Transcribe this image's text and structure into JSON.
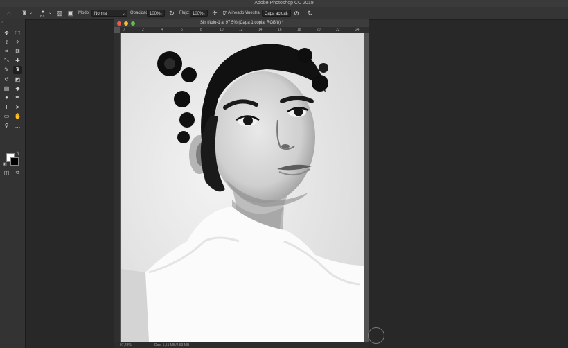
{
  "app": {
    "title": "Adobe Photoshop CC 2019"
  },
  "options": {
    "brush_size": "87",
    "mode_label": "Modo:",
    "mode_value": "Normal",
    "opacity_label": "Opacidad:",
    "opacity_value": "100%",
    "flow_label": "Flujo:",
    "flow_value": "100%",
    "aligned_label": "Alineado",
    "sample_label": "Muestra:",
    "sample_value": "Capa actual"
  },
  "document": {
    "title": "Sin título-1 al 97,5% (Capa 1 copia, RGB/8) *",
    "ruler_ticks": [
      "0",
      "2",
      "4",
      "6",
      "8",
      "10",
      "12",
      "14",
      "16",
      "18",
      "20",
      "22",
      "24"
    ],
    "status_zoom": "97,48%",
    "status_doc": "Doc: 1,51 MB/2,53 MB"
  },
  "tools": [
    {
      "name": "move-tool",
      "glyph": "✥"
    },
    {
      "name": "marquee-tool",
      "glyph": "⬚"
    },
    {
      "name": "lasso-tool",
      "glyph": "ℓ"
    },
    {
      "name": "magic-wand-tool",
      "glyph": "✧"
    },
    {
      "name": "crop-tool",
      "glyph": "⌗"
    },
    {
      "name": "frame-tool",
      "glyph": "⊠"
    },
    {
      "name": "eyedropper-tool",
      "glyph": "⤡"
    },
    {
      "name": "healing-brush-tool",
      "glyph": "✚"
    },
    {
      "name": "brush-tool",
      "glyph": "✎"
    },
    {
      "name": "clone-stamp-tool",
      "glyph": "♜"
    },
    {
      "name": "history-brush-tool",
      "glyph": "↺"
    },
    {
      "name": "eraser-tool",
      "glyph": "◩"
    },
    {
      "name": "gradient-tool",
      "glyph": "▤"
    },
    {
      "name": "blur-tool",
      "glyph": "◆"
    },
    {
      "name": "dodge-tool",
      "glyph": "●"
    },
    {
      "name": "pen-tool",
      "glyph": "✒"
    },
    {
      "name": "type-tool",
      "glyph": "T"
    },
    {
      "name": "path-selection-tool",
      "glyph": "➤"
    },
    {
      "name": "rectangle-tool",
      "glyph": "▭"
    },
    {
      "name": "hand-tool",
      "glyph": "✋"
    },
    {
      "name": "zoom-tool",
      "glyph": "⚲"
    },
    {
      "name": "more-tools",
      "glyph": "…"
    }
  ],
  "colors": {
    "accent_close": "#ee5a52",
    "accent_min": "#f5bd2f",
    "accent_max": "#5dc143"
  }
}
